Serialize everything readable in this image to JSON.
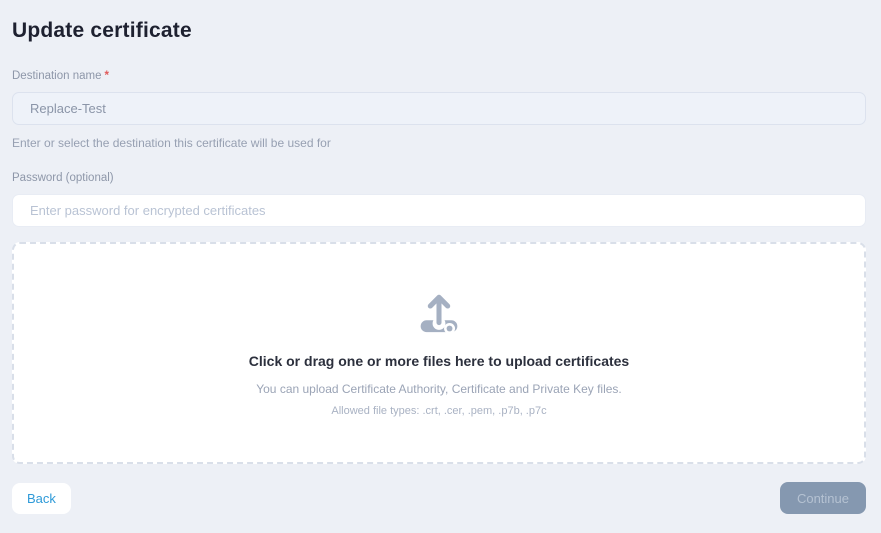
{
  "page": {
    "title": "Update certificate"
  },
  "form": {
    "destination": {
      "label": "Destination name",
      "required_marker": "*",
      "value": "Replace-Test",
      "helper": "Enter or select the destination this certificate will be used for"
    },
    "password": {
      "label": "Password (optional)",
      "placeholder": "Enter password for encrypted certificates"
    },
    "upload": {
      "main_text": "Click or drag one or more files here to upload certificates",
      "sub_text": "You can upload Certificate Authority, Certificate and Private Key files.",
      "allowed_text": "Allowed file types: .crt, .cer, .pem, .p7b, .p7c",
      "icon": "upload-tray-icon"
    }
  },
  "footer": {
    "back_label": "Back",
    "continue_label": "Continue"
  },
  "colors": {
    "page_background": "#edf0f6",
    "title_text": "#1e2130",
    "label_text": "#8e97a9",
    "required_red": "#e05a5a",
    "filled_input_bg": "#eef2f9",
    "filled_input_text": "#8b95a8",
    "placeholder_text": "#b9c3d4",
    "dropzone_border": "#d9dfe9",
    "upload_icon_gray": "#a5b0c2",
    "back_button_text": "#2e9ad8",
    "continue_button_bg": "#8598b0",
    "continue_button_text": "#b5c2d2"
  }
}
